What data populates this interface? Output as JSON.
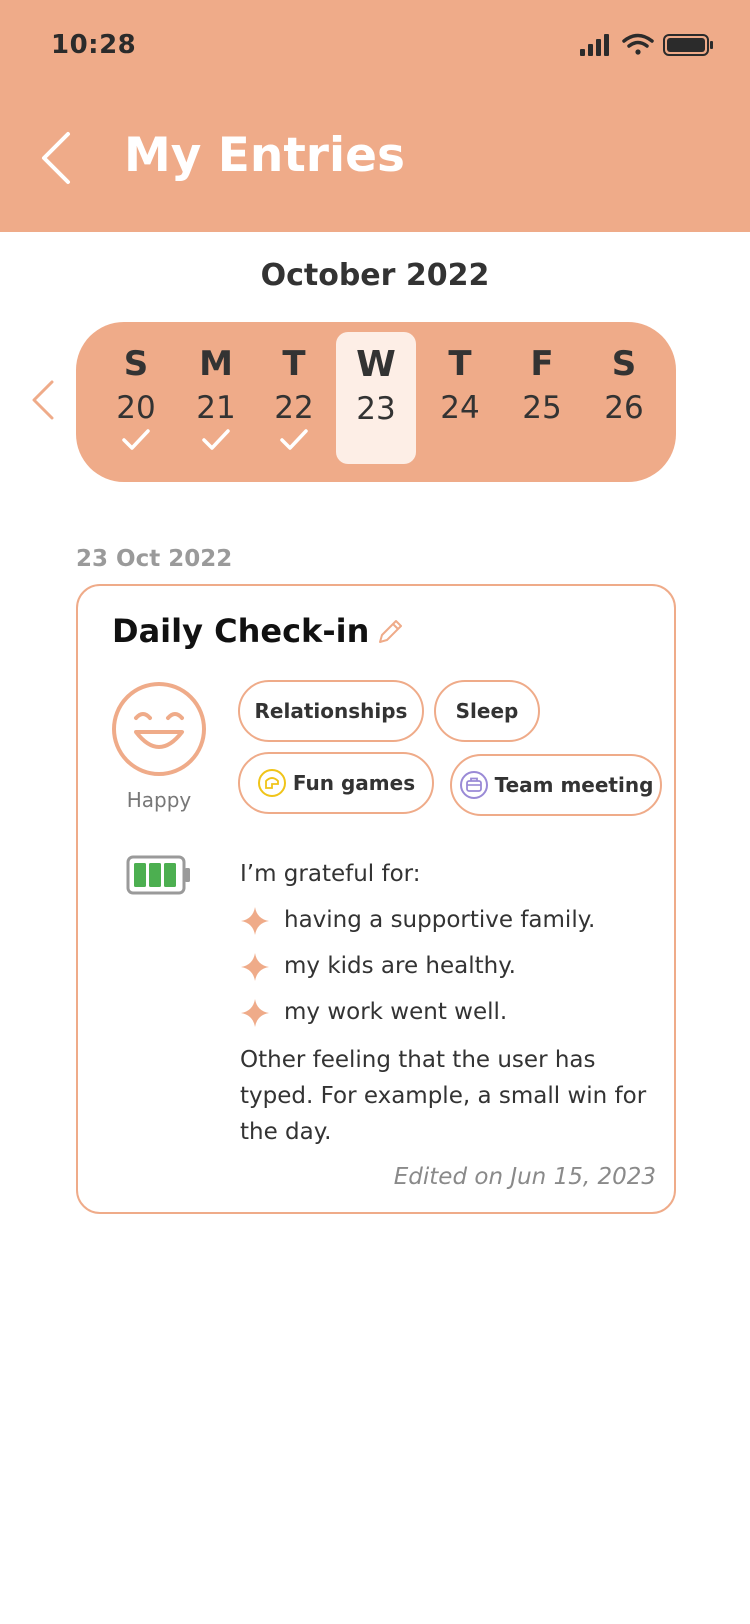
{
  "status_bar": {
    "time": "10:28"
  },
  "header": {
    "title": "My Entries"
  },
  "calendar": {
    "month_label": "October 2022",
    "days": [
      {
        "dow": "S",
        "date": "20",
        "checked": true
      },
      {
        "dow": "M",
        "date": "21",
        "checked": true
      },
      {
        "dow": "T",
        "date": "22",
        "checked": true
      },
      {
        "dow": "W",
        "date": "23",
        "checked": false,
        "selected": true
      },
      {
        "dow": "T",
        "date": "24",
        "checked": false
      },
      {
        "dow": "F",
        "date": "25",
        "checked": false
      },
      {
        "dow": "S",
        "date": "26",
        "checked": false
      }
    ]
  },
  "entry": {
    "date_label": "23 Oct 2022",
    "title": "Daily Check-in",
    "mood": {
      "label": "Happy",
      "icon": "happy-face-icon"
    },
    "tags": [
      {
        "label": "Relationships"
      },
      {
        "label": "Sleep"
      },
      {
        "label": "Fun games",
        "icon": "fun-games-icon"
      },
      {
        "label": "Team meeting",
        "icon": "briefcase-icon"
      }
    ],
    "energy": {
      "icon": "battery-icon",
      "level": 0.75
    },
    "grateful_title": "I’m grateful for:",
    "grateful_items": [
      "having a supportive family.",
      "my kids are healthy.",
      "my work went well."
    ],
    "other_text": "Other feeling that the user has typed. For example, a small win for the day.",
    "edited_label": "Edited on Jun 15, 2023"
  },
  "colors": {
    "accent": "#efab89",
    "selected_day": "#fdeee6",
    "battery_green": "#4caf50",
    "fun_games_icon": "#f0c419",
    "team_meeting_icon": "#9a8ad6"
  }
}
